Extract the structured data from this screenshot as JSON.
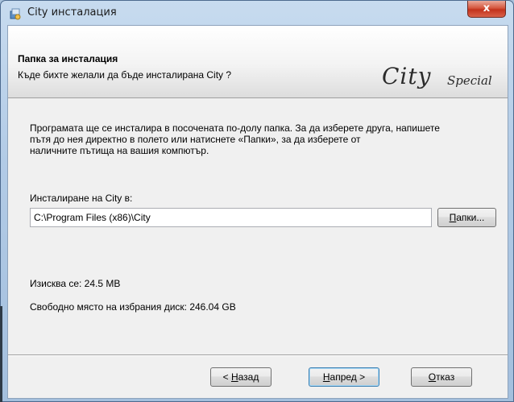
{
  "window": {
    "title": "City инсталация",
    "close_label": "x"
  },
  "header": {
    "title": "Папка за инсталация",
    "subtitle": "Къде бихте желали да бъде инсталирана City ?",
    "logo_main": "City",
    "logo_sub": "Special"
  },
  "body": {
    "description_line1": "Програмата ще се инсталира в посочената по-долу папка. За да изберете друга, напишете",
    "description_line2": "пътя до нея директно в полето или натиснете «Папки», за да изберете от",
    "description_line3": "наличните пътища на вашия компютър.",
    "install_label": "Инсталиране на City в:",
    "install_path": "C:\\Program Files (x86)\\City",
    "browse_label_u": "П",
    "browse_label_rest": "апки...",
    "required_space": "Изисква се: 24.5 MB",
    "free_space": "Свободно място на избрания диск: 246.04 GB"
  },
  "footer": {
    "back_prefix": "< ",
    "back_u": "Н",
    "back_rest": "азад",
    "next_u": "Н",
    "next_rest": "апред >",
    "cancel_u": "О",
    "cancel_rest": "тказ"
  },
  "colors": {
    "accent": "#3c7fb1",
    "close_button": "#c2321c"
  },
  "icons": {
    "app": "installer-app-icon",
    "close": "close-icon"
  }
}
